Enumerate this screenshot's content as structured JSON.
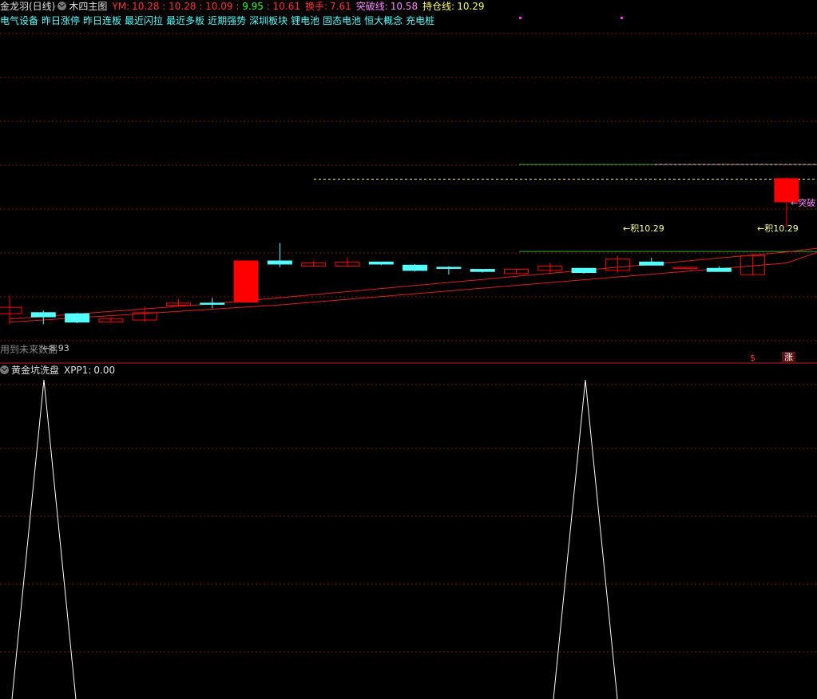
{
  "header": {
    "stock_name": "金龙羽(日线)",
    "main_indicator": "木四主图",
    "ym_label": "YM:",
    "ym_values": [
      "10.28",
      "10.28",
      "10.09",
      "9.95",
      "10.61"
    ],
    "turnover_label": "换手:",
    "turnover_value": "7.61",
    "breakout_label": "突破线:",
    "breakout_value": "10.58",
    "hold_label": "持仓线:",
    "hold_value": "10.29"
  },
  "concepts": [
    "电气设备",
    "昨日涨停",
    "昨日连板",
    "最近闪拉",
    "最近多板",
    "近期强势",
    "深圳板块",
    "锂电池",
    "固态电池",
    "恒大概念",
    "充电桩"
  ],
  "annotations": {
    "hold_label_1": "←积10.29",
    "hold_label_2": "←积10.29",
    "breakout_label": "←突破",
    "future_data_warning": "用到未来数据",
    "low_price": "←8.93",
    "badge_s": "$",
    "badge_zhang": "涨"
  },
  "sub_indicator": {
    "name": "黄金坑洗盘",
    "label": "XPP1:",
    "value": "0.00",
    "spike_positions": [
      2,
      30
    ],
    "spike_value": 1
  },
  "colors": {
    "background": "#000000",
    "up": "#ff0000",
    "down": "#54ffff",
    "grid": "#7a1a1a",
    "ma": "#dd2020",
    "hold_line": "#ffff66",
    "breakout_line": "#33aa33",
    "xpp": "#ffffff"
  },
  "chart_data": {
    "type": "candlestick",
    "price_range": [
      8.6,
      11.7
    ],
    "candles": [
      {
        "o": 9.03,
        "h": 9.2,
        "l": 8.93,
        "c": 9.09,
        "style": "up-hollow"
      },
      {
        "o": 9.04,
        "h": 9.06,
        "l": 8.93,
        "c": 9.0,
        "style": "down"
      },
      {
        "o": 9.03,
        "h": 9.04,
        "l": 8.94,
        "c": 8.95,
        "style": "down"
      },
      {
        "o": 8.95,
        "h": 9.0,
        "l": 8.95,
        "c": 8.98,
        "style": "up-hollow"
      },
      {
        "o": 8.97,
        "h": 9.1,
        "l": 8.95,
        "c": 9.04,
        "style": "up-hollow"
      },
      {
        "o": 9.11,
        "h": 9.17,
        "l": 9.1,
        "c": 9.13,
        "style": "up-hollow"
      },
      {
        "o": 9.13,
        "h": 9.18,
        "l": 9.08,
        "c": 9.13,
        "style": "doji-down"
      },
      {
        "o": 9.14,
        "h": 9.53,
        "l": 9.14,
        "c": 9.53,
        "style": "up-filled"
      },
      {
        "o": 9.53,
        "h": 9.7,
        "l": 9.47,
        "c": 9.5,
        "style": "down"
      },
      {
        "o": 9.48,
        "h": 9.53,
        "l": 9.48,
        "c": 9.51,
        "style": "up-hollow"
      },
      {
        "o": 9.48,
        "h": 9.56,
        "l": 9.48,
        "c": 9.52,
        "style": "up-hollow"
      },
      {
        "o": 9.52,
        "h": 9.52,
        "l": 9.49,
        "c": 9.5,
        "style": "down"
      },
      {
        "o": 9.49,
        "h": 9.5,
        "l": 9.43,
        "c": 9.44,
        "style": "down"
      },
      {
        "o": 9.47,
        "h": 9.48,
        "l": 9.4,
        "c": 9.46,
        "style": "down"
      },
      {
        "o": 9.45,
        "h": 9.45,
        "l": 9.42,
        "c": 9.43,
        "style": "down"
      },
      {
        "o": 9.41,
        "h": 9.45,
        "l": 9.41,
        "c": 9.45,
        "style": "up-hollow"
      },
      {
        "o": 9.44,
        "h": 9.51,
        "l": 9.41,
        "c": 9.48,
        "style": "up-hollow"
      },
      {
        "o": 9.46,
        "h": 9.46,
        "l": 9.41,
        "c": 9.42,
        "style": "down"
      },
      {
        "o": 9.44,
        "h": 9.58,
        "l": 9.42,
        "c": 9.55,
        "style": "up-hollow"
      },
      {
        "o": 9.52,
        "h": 9.56,
        "l": 9.49,
        "c": 9.49,
        "style": "down"
      },
      {
        "o": 9.47,
        "h": 9.47,
        "l": 9.46,
        "c": 9.47,
        "style": "doji-up"
      },
      {
        "o": 9.46,
        "h": 9.48,
        "l": 9.44,
        "c": 9.43,
        "style": "down"
      },
      {
        "o": 9.4,
        "h": 9.6,
        "l": 9.4,
        "c": 9.58,
        "style": "up-hollow"
      },
      {
        "o": 10.09,
        "h": 10.32,
        "l": 9.85,
        "c": 10.31,
        "style": "up-filled"
      }
    ]
  }
}
